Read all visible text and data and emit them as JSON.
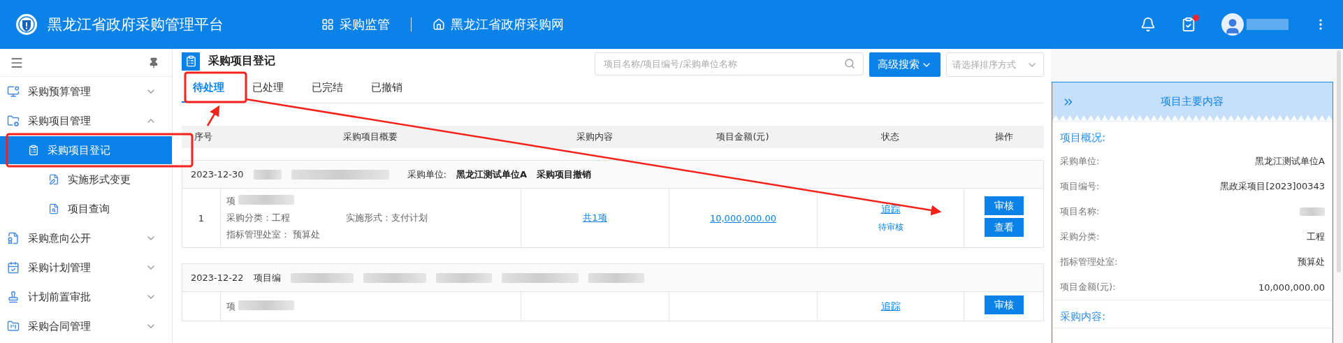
{
  "header": {
    "title": "黑龙江省政府采购管理平台",
    "nav": [
      {
        "label": "采购监管"
      },
      {
        "label": "黑龙江省政府采购网"
      }
    ],
    "task_badge": true
  },
  "sidebar": {
    "items": [
      {
        "label": "采购预算管理",
        "expanded": false
      },
      {
        "label": "采购项目管理",
        "expanded": true,
        "children": [
          {
            "label": "采购项目登记",
            "selected": true
          },
          {
            "label": "实施形式变更",
            "selected": false
          },
          {
            "label": "项目查询",
            "selected": false
          }
        ]
      },
      {
        "label": "采购意向公开",
        "expanded": false
      },
      {
        "label": "采购计划管理",
        "expanded": false
      },
      {
        "label": "计划前置审批",
        "expanded": false
      },
      {
        "label": "采购合同管理",
        "expanded": false
      }
    ]
  },
  "page": {
    "title": "采购项目登记",
    "tabs": [
      {
        "label": "待处理",
        "selected": true
      },
      {
        "label": "已处理",
        "selected": false
      },
      {
        "label": "已完结",
        "selected": false
      },
      {
        "label": "已撤销",
        "selected": false
      }
    ],
    "search": {
      "placeholder": "项目名称/项目编号/采购单位名称"
    },
    "advanced_search": "高级搜索",
    "sort": {
      "placeholder": "请选择排序方式"
    }
  },
  "table": {
    "columns": [
      "序号",
      "采购项目概要",
      "采购内容",
      "项目金额(元)",
      "状态",
      "操作"
    ],
    "groups": [
      {
        "date": "2023-12-30",
        "redacted": true,
        "unit_label": "采购单位:",
        "unit": "黑龙江测试单位A",
        "note": "采购项目撤销",
        "row": {
          "index": "1",
          "summary": [
            [
              {
                "text": "项",
                "redacted": true
              }
            ],
            [
              {
                "text": "采购分类：工程",
                "redacted": false
              },
              {
                "text": "实施形式：支付计划",
                "redacted": false
              }
            ],
            [
              {
                "text": "指标管理处室：  预算处",
                "redacted": false
              }
            ]
          ],
          "content": "共1项",
          "amount": "10,000,000.00",
          "track": "追踪",
          "status": "待审核",
          "actions": [
            "审核",
            "查看"
          ]
        }
      },
      {
        "date": "2023-12-22",
        "prefix": "项目编",
        "redacted": true,
        "row": {
          "summary": [
            [
              {
                "text": "项",
                "redacted": true
              }
            ]
          ],
          "track": "追踪",
          "actions": [
            "审核"
          ]
        }
      }
    ]
  },
  "panel": {
    "title": "项目主要内容",
    "sections": [
      {
        "heading": "项目概况:",
        "fields": [
          {
            "label": "采购单位:",
            "value": "黑龙江测试单位A"
          },
          {
            "label": "项目编号:",
            "value": "黑政采项目[2023]00343"
          },
          {
            "label": "项目名称:",
            "redacted": true
          },
          {
            "label": "采购分类:",
            "value": "工程"
          },
          {
            "label": "指标管理处室:",
            "value": "预算处"
          },
          {
            "label": "项目金额(元):",
            "value": "10,000,000.00"
          }
        ]
      },
      {
        "heading": "采购内容:"
      }
    ]
  }
}
